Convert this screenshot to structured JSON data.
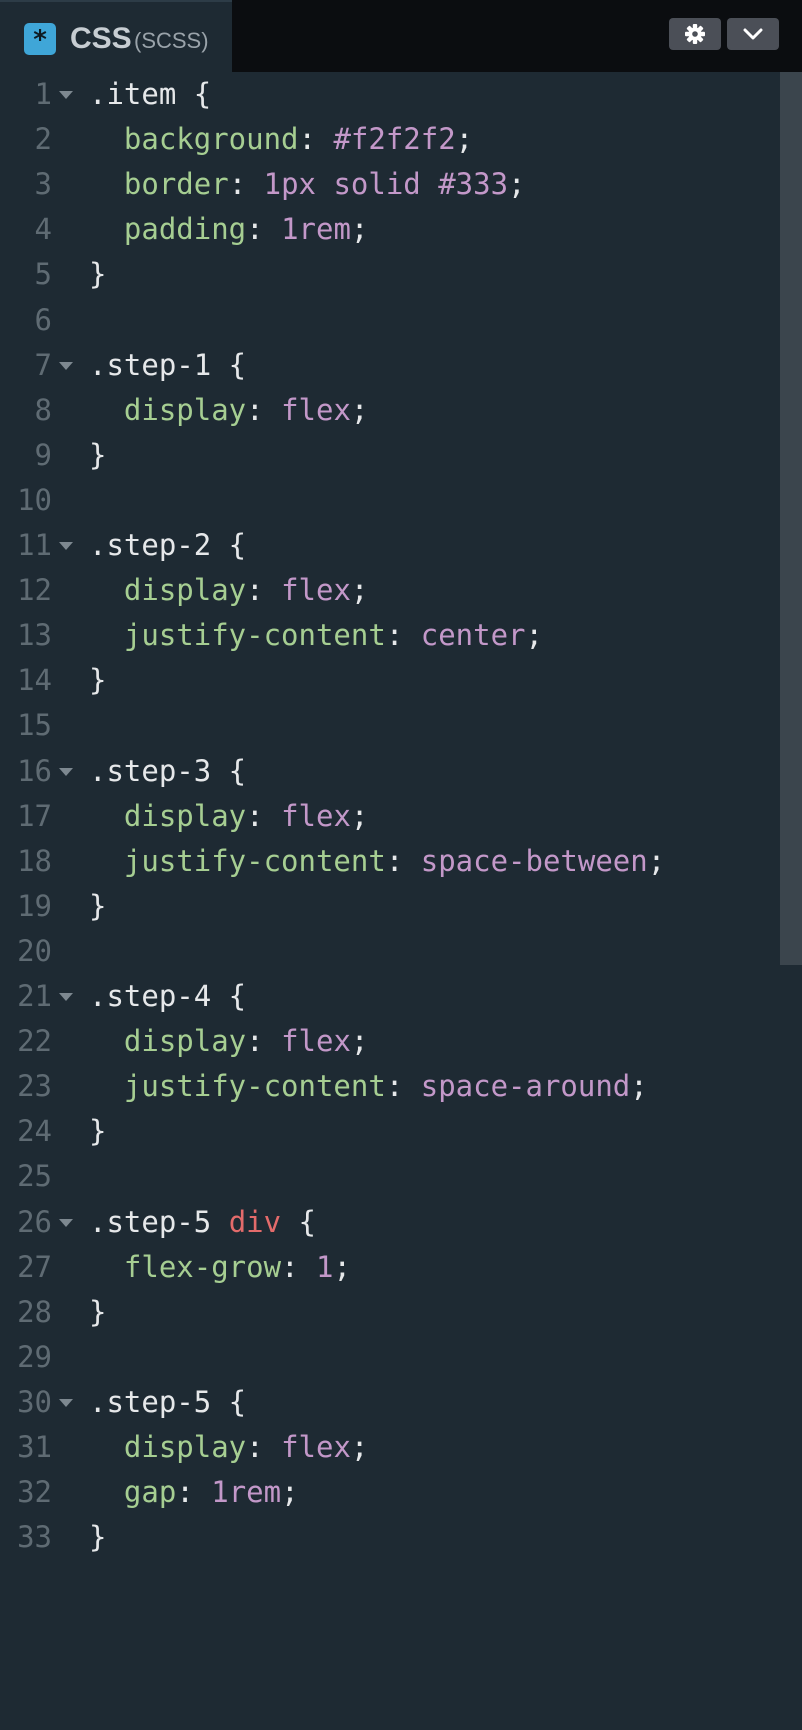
{
  "header": {
    "tab_title": "CSS",
    "tab_subtitle": "(SCSS)",
    "tab_icon": "asterisk-icon",
    "tab_icon_glyph": "*",
    "settings_icon": "gear-icon",
    "collapse_icon": "chevron-down-icon"
  },
  "colors": {
    "background": "#1e2a33",
    "header_background": "#0b0d10",
    "line_number": "#5f6b73",
    "property": "#a6ce92",
    "value": "#c398c9",
    "tag": "#e36b6b",
    "text": "#e6e8ea",
    "tab_icon": "#3fa6d8"
  },
  "editor": {
    "lines": [
      {
        "n": "1",
        "fold": true,
        "tokens": [
          {
            "t": "sel",
            "v": ".item"
          },
          {
            "t": "punc",
            "v": " {"
          }
        ]
      },
      {
        "n": "2",
        "fold": false,
        "tokens": [
          {
            "t": "punc",
            "v": "  "
          },
          {
            "t": "prop",
            "v": "background"
          },
          {
            "t": "punc",
            "v": ": "
          },
          {
            "t": "val",
            "v": "#f2f2f2"
          },
          {
            "t": "punc",
            "v": ";"
          }
        ]
      },
      {
        "n": "3",
        "fold": false,
        "tokens": [
          {
            "t": "punc",
            "v": "  "
          },
          {
            "t": "prop",
            "v": "border"
          },
          {
            "t": "punc",
            "v": ": "
          },
          {
            "t": "val",
            "v": "1px solid #333"
          },
          {
            "t": "punc",
            "v": ";"
          }
        ]
      },
      {
        "n": "4",
        "fold": false,
        "tokens": [
          {
            "t": "punc",
            "v": "  "
          },
          {
            "t": "prop",
            "v": "padding"
          },
          {
            "t": "punc",
            "v": ": "
          },
          {
            "t": "val",
            "v": "1rem"
          },
          {
            "t": "punc",
            "v": ";"
          }
        ]
      },
      {
        "n": "5",
        "fold": false,
        "tokens": [
          {
            "t": "punc",
            "v": "}"
          }
        ]
      },
      {
        "n": "6",
        "fold": false,
        "tokens": []
      },
      {
        "n": "7",
        "fold": true,
        "tokens": [
          {
            "t": "sel",
            "v": ".step-1"
          },
          {
            "t": "punc",
            "v": " {"
          }
        ]
      },
      {
        "n": "8",
        "fold": false,
        "tokens": [
          {
            "t": "punc",
            "v": "  "
          },
          {
            "t": "prop",
            "v": "display"
          },
          {
            "t": "punc",
            "v": ": "
          },
          {
            "t": "val",
            "v": "flex"
          },
          {
            "t": "punc",
            "v": ";"
          }
        ]
      },
      {
        "n": "9",
        "fold": false,
        "tokens": [
          {
            "t": "punc",
            "v": "}"
          }
        ]
      },
      {
        "n": "10",
        "fold": false,
        "tokens": []
      },
      {
        "n": "11",
        "fold": true,
        "tokens": [
          {
            "t": "sel",
            "v": ".step-2"
          },
          {
            "t": "punc",
            "v": " {"
          }
        ]
      },
      {
        "n": "12",
        "fold": false,
        "tokens": [
          {
            "t": "punc",
            "v": "  "
          },
          {
            "t": "prop",
            "v": "display"
          },
          {
            "t": "punc",
            "v": ": "
          },
          {
            "t": "val",
            "v": "flex"
          },
          {
            "t": "punc",
            "v": ";"
          }
        ]
      },
      {
        "n": "13",
        "fold": false,
        "tokens": [
          {
            "t": "punc",
            "v": "  "
          },
          {
            "t": "prop",
            "v": "justify-content"
          },
          {
            "t": "punc",
            "v": ": "
          },
          {
            "t": "val",
            "v": "center"
          },
          {
            "t": "punc",
            "v": ";"
          }
        ]
      },
      {
        "n": "14",
        "fold": false,
        "tokens": [
          {
            "t": "punc",
            "v": "}"
          }
        ]
      },
      {
        "n": "15",
        "fold": false,
        "tokens": []
      },
      {
        "n": "16",
        "fold": true,
        "tokens": [
          {
            "t": "sel",
            "v": ".step-3"
          },
          {
            "t": "punc",
            "v": " {"
          }
        ]
      },
      {
        "n": "17",
        "fold": false,
        "tokens": [
          {
            "t": "punc",
            "v": "  "
          },
          {
            "t": "prop",
            "v": "display"
          },
          {
            "t": "punc",
            "v": ": "
          },
          {
            "t": "val",
            "v": "flex"
          },
          {
            "t": "punc",
            "v": ";"
          }
        ]
      },
      {
        "n": "18",
        "fold": false,
        "tokens": [
          {
            "t": "punc",
            "v": "  "
          },
          {
            "t": "prop",
            "v": "justify-content"
          },
          {
            "t": "punc",
            "v": ": "
          },
          {
            "t": "val",
            "v": "space-between"
          },
          {
            "t": "punc",
            "v": ";"
          }
        ]
      },
      {
        "n": "19",
        "fold": false,
        "tokens": [
          {
            "t": "punc",
            "v": "}"
          }
        ]
      },
      {
        "n": "20",
        "fold": false,
        "tokens": []
      },
      {
        "n": "21",
        "fold": true,
        "tokens": [
          {
            "t": "sel",
            "v": ".step-4"
          },
          {
            "t": "punc",
            "v": " {"
          }
        ]
      },
      {
        "n": "22",
        "fold": false,
        "tokens": [
          {
            "t": "punc",
            "v": "  "
          },
          {
            "t": "prop",
            "v": "display"
          },
          {
            "t": "punc",
            "v": ": "
          },
          {
            "t": "val",
            "v": "flex"
          },
          {
            "t": "punc",
            "v": ";"
          }
        ]
      },
      {
        "n": "23",
        "fold": false,
        "tokens": [
          {
            "t": "punc",
            "v": "  "
          },
          {
            "t": "prop",
            "v": "justify-content"
          },
          {
            "t": "punc",
            "v": ": "
          },
          {
            "t": "val",
            "v": "space-around"
          },
          {
            "t": "punc",
            "v": ";"
          }
        ]
      },
      {
        "n": "24",
        "fold": false,
        "tokens": [
          {
            "t": "punc",
            "v": "}"
          }
        ]
      },
      {
        "n": "25",
        "fold": false,
        "tokens": []
      },
      {
        "n": "26",
        "fold": true,
        "tokens": [
          {
            "t": "sel",
            "v": ".step-5"
          },
          {
            "t": "punc",
            "v": " "
          },
          {
            "t": "tag",
            "v": "div"
          },
          {
            "t": "punc",
            "v": " {"
          }
        ]
      },
      {
        "n": "27",
        "fold": false,
        "tokens": [
          {
            "t": "punc",
            "v": "  "
          },
          {
            "t": "prop",
            "v": "flex-grow"
          },
          {
            "t": "punc",
            "v": ": "
          },
          {
            "t": "val",
            "v": "1"
          },
          {
            "t": "punc",
            "v": ";"
          }
        ]
      },
      {
        "n": "28",
        "fold": false,
        "tokens": [
          {
            "t": "punc",
            "v": "}"
          }
        ]
      },
      {
        "n": "29",
        "fold": false,
        "tokens": []
      },
      {
        "n": "30",
        "fold": true,
        "tokens": [
          {
            "t": "sel",
            "v": ".step-5"
          },
          {
            "t": "punc",
            "v": " {"
          }
        ]
      },
      {
        "n": "31",
        "fold": false,
        "tokens": [
          {
            "t": "punc",
            "v": "  "
          },
          {
            "t": "prop",
            "v": "display"
          },
          {
            "t": "punc",
            "v": ": "
          },
          {
            "t": "val",
            "v": "flex"
          },
          {
            "t": "punc",
            "v": ";"
          }
        ]
      },
      {
        "n": "32",
        "fold": false,
        "tokens": [
          {
            "t": "punc",
            "v": "  "
          },
          {
            "t": "prop",
            "v": "gap"
          },
          {
            "t": "punc",
            "v": ": "
          },
          {
            "t": "val",
            "v": "1rem"
          },
          {
            "t": "punc",
            "v": ";"
          }
        ]
      },
      {
        "n": "33",
        "fold": false,
        "tokens": [
          {
            "t": "punc",
            "v": "}"
          }
        ]
      }
    ]
  }
}
